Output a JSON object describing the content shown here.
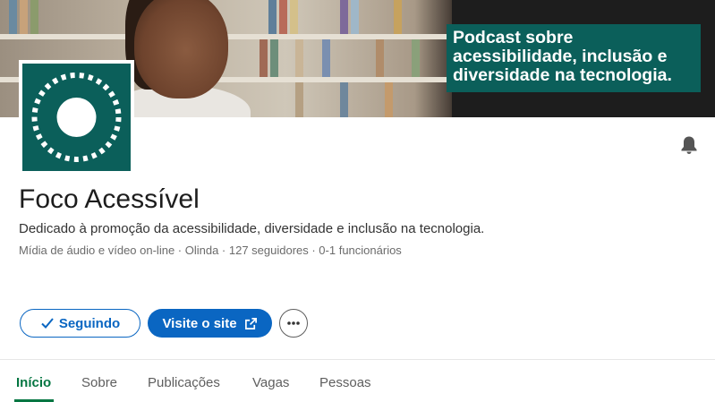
{
  "banner": {
    "text": "Podcast sobre\nacessibilidade, inclusão e\ndiversidade na tecnologia."
  },
  "company": {
    "name": "Foco Acessível",
    "tagline": "Dedicado à promoção da acessibilidade, diversidade e inclusão na tecnologia.",
    "meta": "Mídia de áudio e vídeo on-line · Olinda · 127 seguidores · 0-1 funcionários"
  },
  "actions": {
    "following_label": "Seguindo",
    "visit_label": "Visite o site"
  },
  "tabs": [
    {
      "label": "Início",
      "active": true
    },
    {
      "label": "Sobre",
      "active": false
    },
    {
      "label": "Publicações",
      "active": false
    },
    {
      "label": "Vagas",
      "active": false
    },
    {
      "label": "Pessoas",
      "active": false
    }
  ],
  "colors": {
    "brand_teal": "#0b5f5a",
    "primary_blue": "#0a66c2",
    "active_tab_green": "#057642"
  },
  "icons": {
    "notification": "bell-icon",
    "following": "check-icon",
    "visit": "external-link-icon",
    "more": "ellipsis-icon"
  }
}
